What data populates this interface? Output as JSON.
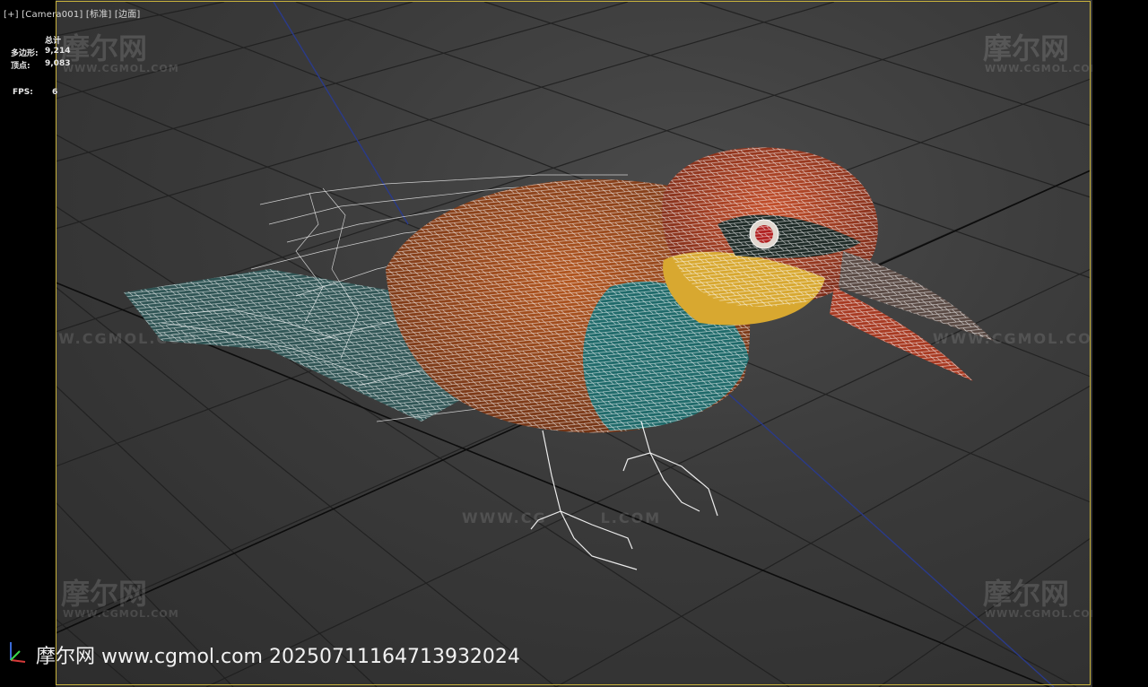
{
  "viewport": {
    "label_parts": [
      "[+]",
      "[Camera001]",
      "[标准]",
      "[边面]"
    ]
  },
  "stats": {
    "header": "总计",
    "polys_label": "多边形:",
    "polys_value": "9,214",
    "verts_label": "顶点:",
    "verts_value": "9,083",
    "fps_label": "FPS:",
    "fps_value": "6"
  },
  "watermark": {
    "logo": "摩尔网",
    "sub": "WWW.CGMOL.COM",
    "url": "WWW.CGMOL.COM",
    "url_mid_a": "WWW.CG",
    "url_mid_b": "L.COM",
    "bottom": "摩尔网 www.cgmol.com 20250711164713932024"
  },
  "colors": {
    "viewport_bg": "#3a3a3a",
    "active_border": "#c8b23c",
    "grid_line": "#141414",
    "axis_line": "#2a3a8a"
  },
  "icons": {
    "axis_gizmo": "axis-gizmo-icon"
  }
}
